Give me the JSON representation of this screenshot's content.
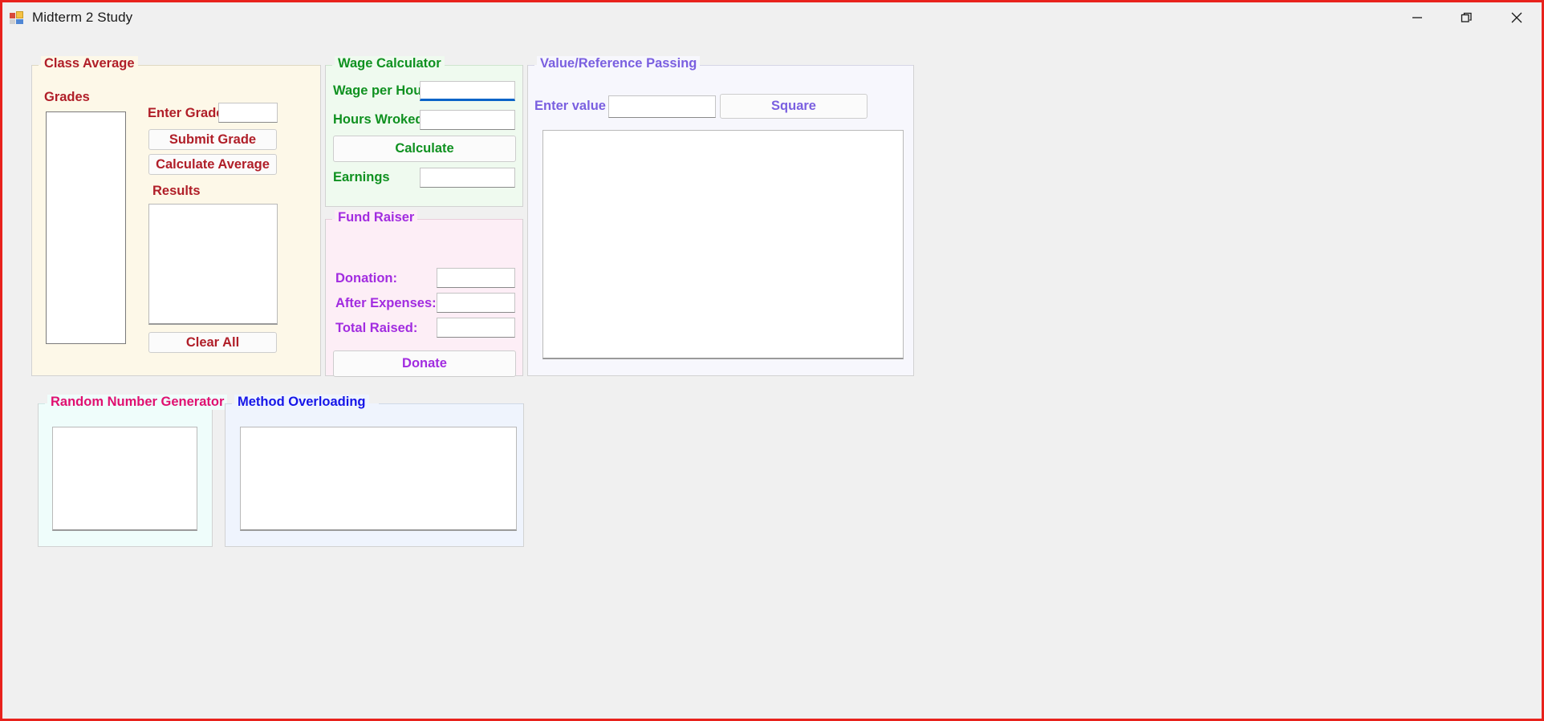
{
  "window": {
    "title": "Midterm 2 Study",
    "icon": "windows-forms-icon",
    "frame_color": "#e8221c",
    "controls": [
      {
        "name": "minimize",
        "glyph": "minimize-icon"
      },
      {
        "name": "restore",
        "glyph": "restore-icon"
      },
      {
        "name": "close",
        "glyph": "close-icon"
      }
    ]
  },
  "class_average": {
    "title": "Class Average",
    "fore_color": "#b01e28",
    "back_color": "#fdf8e8",
    "grades_label": "Grades",
    "grades_list_value": "",
    "enter_grade_label": "Enter Grade",
    "enter_grade_value": "",
    "submit_grade_label": "Submit Grade",
    "calculate_average_label": "Calculate Average",
    "results_label": "Results",
    "results_value": "",
    "clear_all_label": "Clear All"
  },
  "wage_calculator": {
    "title": "Wage Calculator",
    "fore_color": "#0f9120",
    "back_color": "#effaef",
    "wage_per_hour_label": "Wage per Hour",
    "wage_per_hour_value": "",
    "hours_worked_label": "Hours Wroked",
    "hours_worked_value": "",
    "calculate_label": "Calculate",
    "earnings_label": "Earnings",
    "earnings_value": ""
  },
  "fund_raiser": {
    "title": "Fund Raiser",
    "fore_color": "#a22ce0",
    "back_color": "#fdeef6",
    "donation_label": "Donation:",
    "donation_value": "",
    "after_expenses_label": "After Expenses:",
    "after_expenses_value": "",
    "total_raised_label": "Total Raised:",
    "total_raised_value": "",
    "donate_label": "Donate"
  },
  "value_reference": {
    "title": "Value/Reference Passing",
    "fore_color": "#7a5fe0",
    "back_color": "#f7f7fd",
    "enter_value_label": "Enter value",
    "enter_value_value": "",
    "square_label": "Square",
    "output_value": ""
  },
  "random_number": {
    "title": "Random Number Generator",
    "fore_color": "#e01070",
    "back_color": "#effdfb",
    "output_value": ""
  },
  "method_overloading": {
    "title": "Method Overloading",
    "fore_color": "#1515e8",
    "back_color": "#eff4fd",
    "output_value": ""
  }
}
